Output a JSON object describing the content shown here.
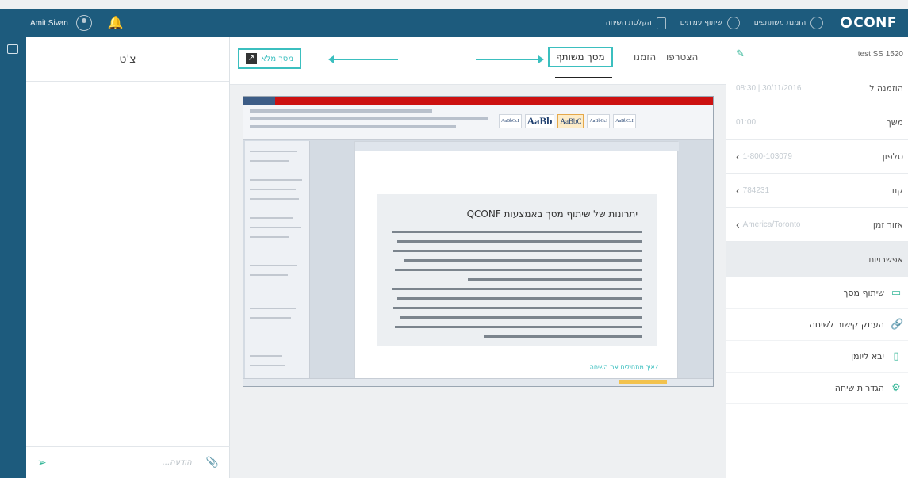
{
  "topbar": {
    "user_name": "Amit Sivan",
    "items": [
      {
        "label": "הזמנת משתתפים",
        "icon": "user-plus-icon"
      },
      {
        "label": "שיתוף עמיתים",
        "icon": "clock-icon"
      },
      {
        "label": "הקלטת השיחה",
        "icon": "document-icon"
      }
    ],
    "brand": "CONF"
  },
  "chat": {
    "title": "צ'ט",
    "placeholder": "...הודעה"
  },
  "tabs": {
    "present": "הצטרפו",
    "invite": "הזמנו",
    "shared_screen": "מסך משותף"
  },
  "fullscreen_label": "מסך מלא",
  "document": {
    "title": "יתרונות של שיתוף מסך באמצעות QCONF",
    "link": "?איך מתחילים את השיחה"
  },
  "details": {
    "conference_name": "test SS 1520",
    "rows": [
      {
        "label": "הוזמנה ל",
        "value": "08:30 | 30/11/2016",
        "chevron": false
      },
      {
        "label": "משך",
        "value": "01:00",
        "chevron": false
      },
      {
        "label": "טלפון",
        "value": "1-800-103079",
        "chevron": true
      },
      {
        "label": "קוד",
        "value": "784231",
        "chevron": true
      },
      {
        "label": "אזור זמן",
        "value": "America/Toronto",
        "chevron": true
      }
    ]
  },
  "options": {
    "header": "אפשרויות",
    "items": [
      {
        "label": "שיתוף מסך",
        "icon": "screen-share-icon"
      },
      {
        "label": "העתק קישור לשיחה",
        "icon": "link-icon"
      },
      {
        "label": "יבא ליומן",
        "icon": "calendar-icon"
      },
      {
        "label": "הגדרות שיחה",
        "icon": "settings-icon"
      }
    ]
  },
  "colors": {
    "header": "#1d5b7d",
    "accent": "#3bbfbf",
    "title_bar": "#cc1111"
  }
}
